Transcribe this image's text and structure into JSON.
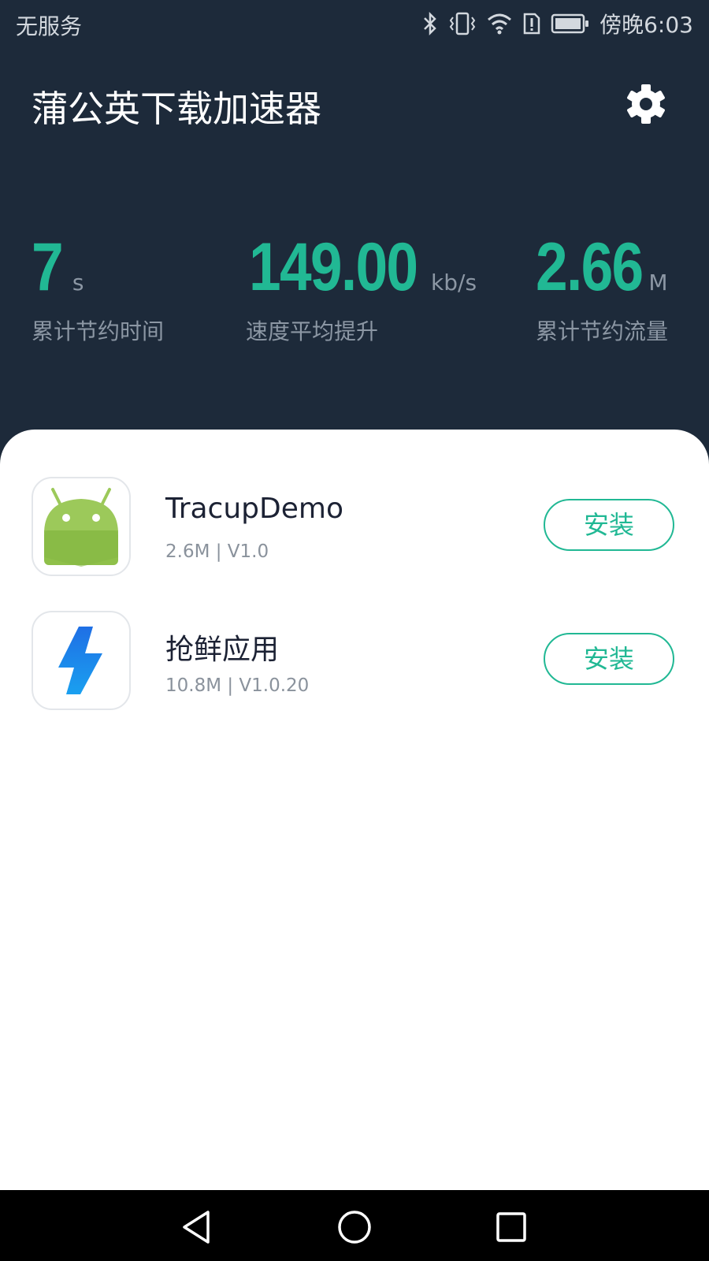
{
  "status_bar": {
    "carrier": "无服务",
    "time": "傍晚6:03",
    "icons": [
      "bluetooth-icon",
      "vibrate-icon",
      "wifi-icon",
      "sim-alert-icon",
      "battery-icon"
    ]
  },
  "header": {
    "title": "蒲公英下载加速器",
    "settings_icon": "gear-icon"
  },
  "stats": [
    {
      "value": "7",
      "unit": "s",
      "label": "累计节约时间"
    },
    {
      "value": "149.00",
      "unit": "kb/s",
      "label": "速度平均提升"
    },
    {
      "value": "2.66",
      "unit": "M",
      "label": "累计节约流量"
    }
  ],
  "apps": [
    {
      "name": "TracupDemo",
      "meta": "2.6M | V1.0",
      "icon": "android-icon",
      "button": "安装"
    },
    {
      "name": "抢鲜应用",
      "meta": "10.8M | V1.0.20",
      "icon": "lightning-icon",
      "button": "安装"
    }
  ],
  "nav": {
    "icons": [
      "back-icon",
      "home-icon",
      "recents-icon"
    ]
  },
  "colors": {
    "header_bg": "#1d2a3a",
    "accent": "#21b894",
    "muted_text": "#8c97a4"
  }
}
